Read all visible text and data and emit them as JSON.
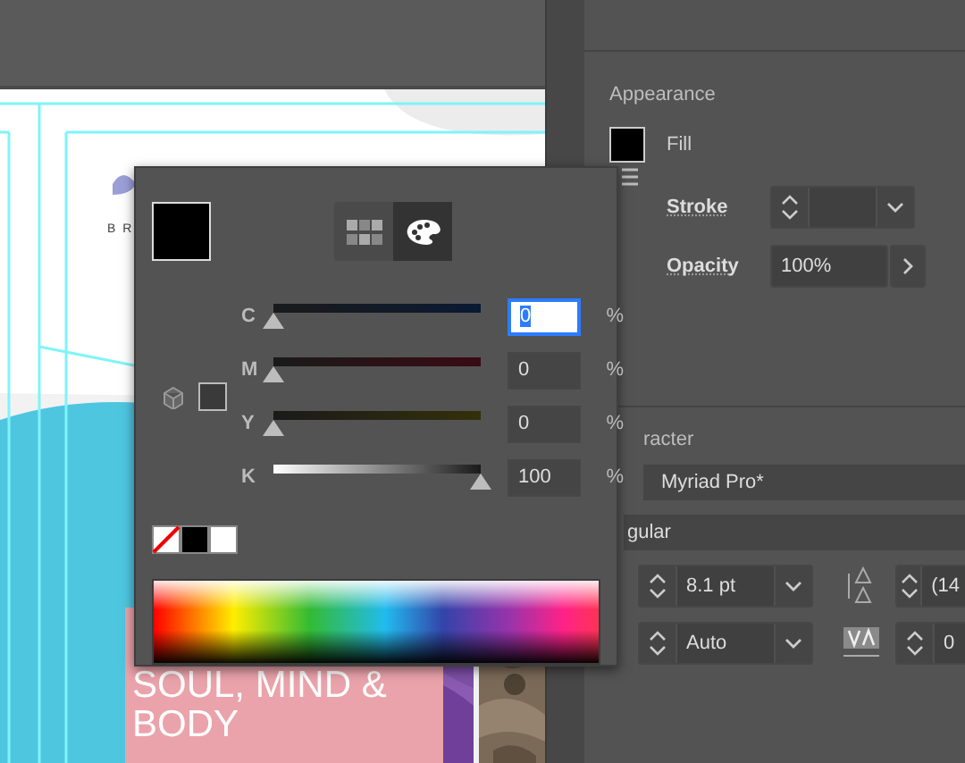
{
  "artboard": {
    "logo_text": "B R",
    "headline": [
      "SOUL, MIND &",
      "BODY"
    ]
  },
  "color_picker": {
    "modes": [
      {
        "kind": "swatches",
        "selected": false
      },
      {
        "kind": "spectrum",
        "selected": true
      }
    ],
    "channels": [
      {
        "label": "C",
        "kind": "cyan",
        "level": 0,
        "value": "0",
        "focused": true,
        "unit": "%"
      },
      {
        "label": "M",
        "kind": "magenta",
        "level": 0,
        "value": "0",
        "focused": false,
        "unit": "%"
      },
      {
        "label": "Y",
        "kind": "yellow",
        "level": 0,
        "value": "0",
        "focused": false,
        "unit": "%"
      },
      {
        "label": "K",
        "kind": "black",
        "level": 1,
        "value": "100",
        "focused": false,
        "unit": "%"
      }
    ],
    "swatches": [
      {
        "kind": "none"
      },
      {
        "kind": "color",
        "color": "#000000"
      },
      {
        "kind": "color",
        "color": "#ffffff"
      }
    ]
  },
  "appearance": {
    "title": "Appearance",
    "fill_label": "Fill",
    "stroke_label": "Stroke",
    "opacity_label": "Opacity",
    "opacity_value": "100%"
  },
  "character": {
    "title": "racter",
    "font_family": "Myriad Pro*",
    "font_style": "gular",
    "font_size": "8.1 pt",
    "leading": "(14",
    "kerning": "Auto",
    "tracking": "0"
  }
}
